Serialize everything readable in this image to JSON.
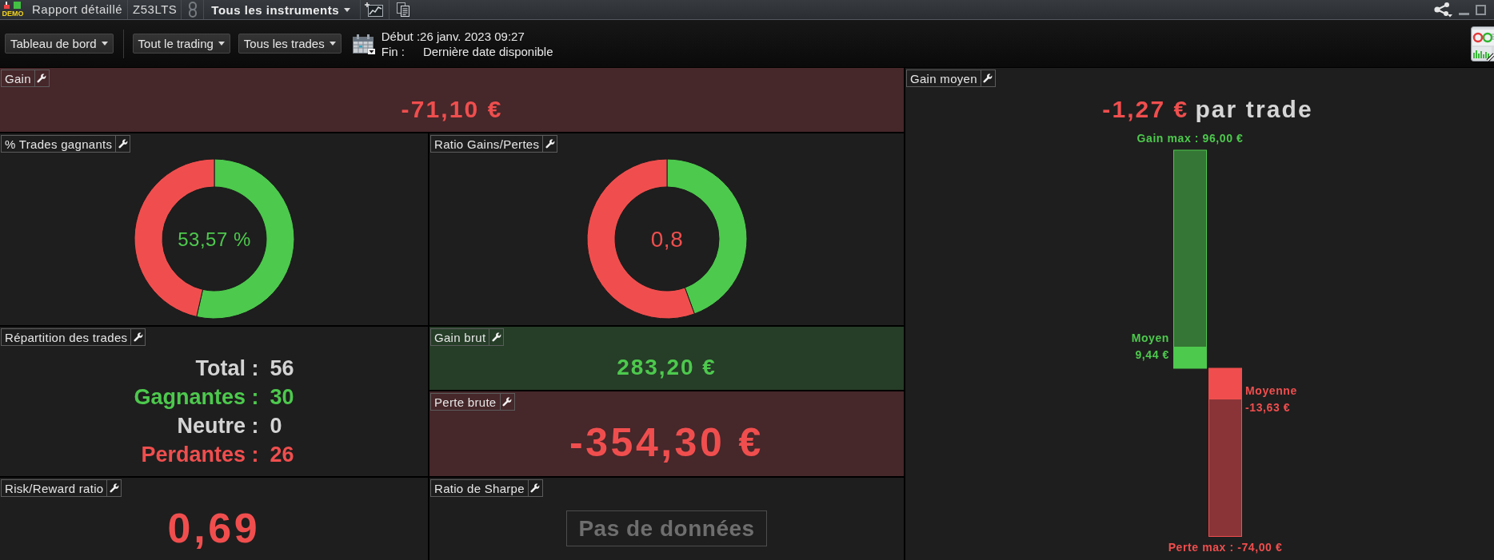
{
  "title_bar": {
    "badge": "DEMO",
    "report": "Rapport détaillé",
    "account": "Z53LTS",
    "instrument_menu": "Tous les instruments"
  },
  "toolbar": {
    "view_menu": "Tableau de bord",
    "filters": [
      "Tout le trading",
      "Tous les trades"
    ],
    "period_start": "Début :26 janv. 2023 09:27",
    "period_end_label": "Fin :",
    "period_end": "Dernière date disponible"
  },
  "gain": {
    "title": "Gain",
    "value": "-71,10 €",
    "negative": true,
    "highlighted": true
  },
  "win_rate": {
    "title": "% Trades gagnants",
    "value": "53,57 %",
    "negative": false,
    "chart_data": {
      "type": "donut",
      "values": [
        53.57,
        46.43
      ]
    }
  },
  "gain_loss_ratio": {
    "title": "Ratio Gains/Pertes",
    "value": "0,8",
    "negative": true,
    "chart_data": {
      "type": "donut",
      "values": [
        44.42,
        55.58
      ]
    }
  },
  "trade_distribution": {
    "title": "Répartition des trades",
    "rows": [
      {
        "label": "Total :",
        "value": "56",
        "color": "#d4d4d4"
      },
      {
        "label": "Gagnantes :",
        "value": "30",
        "color": "#4dc94d"
      },
      {
        "label": "Neutre :",
        "value": "0",
        "color": "#d4d4d4"
      },
      {
        "label": "Perdantes :",
        "value": "26",
        "color": "#f04e4e"
      }
    ]
  },
  "gross_gain": {
    "title": "Gain brut",
    "value": "283,20 €",
    "negative": false,
    "highlighted": true
  },
  "gross_loss": {
    "title": "Perte brute",
    "value": "-354,30 €",
    "negative": true,
    "highlighted": true
  },
  "risk_reward": {
    "title": "Risk/Reward ratio",
    "value": "0,69",
    "negative": true,
    "highlighted": false
  },
  "sharpe_ratio": {
    "title": "Ratio de Sharpe",
    "message": "Pas de données"
  },
  "average_gain": {
    "title": "Gain moyen",
    "value": "-1,27 €",
    "negative": true,
    "unit": "par trade",
    "labels": {
      "max_gain": "Gain max : 96,00 €",
      "average_gain_title": "Moyen",
      "average_gain": "9,44 €",
      "average_loss_title": "Moyenne",
      "average_loss": "-13,63 €",
      "max_loss": "Perte max : -74,00 €"
    }
  }
}
